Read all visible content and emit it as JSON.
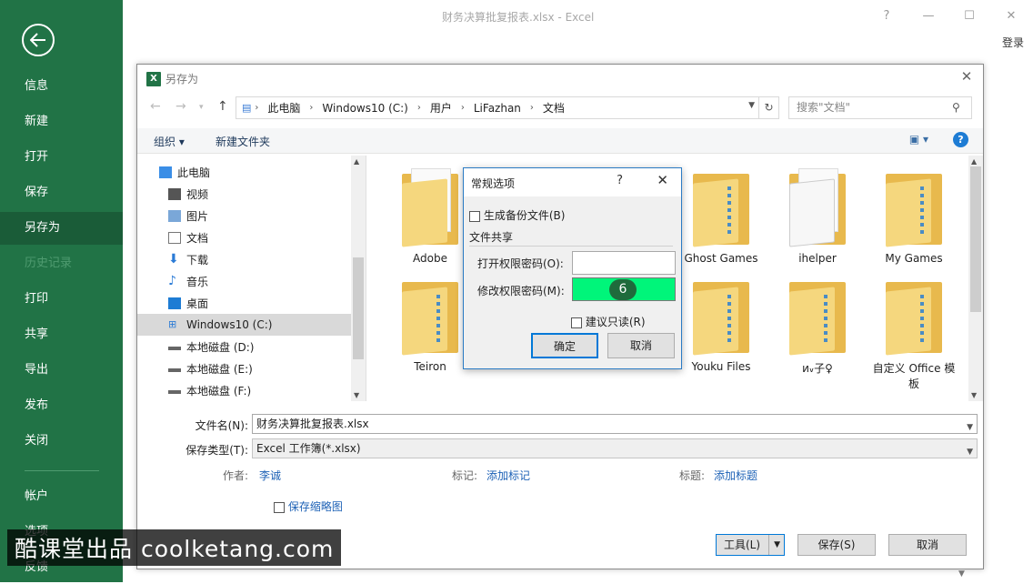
{
  "app": {
    "title": "财务决算批复报表.xlsx - Excel",
    "signin_label": "登录",
    "win_help": "?",
    "win_min": "—",
    "win_max": "☐",
    "win_close": "✕"
  },
  "backstage": {
    "back_icon": "back-arrow-icon",
    "items": [
      {
        "label": "信息"
      },
      {
        "label": "新建"
      },
      {
        "label": "打开"
      },
      {
        "label": "保存"
      },
      {
        "label": "另存为"
      },
      {
        "label": "历史记录"
      },
      {
        "label": "打印"
      },
      {
        "label": "共享"
      },
      {
        "label": "导出"
      },
      {
        "label": "发布"
      },
      {
        "label": "关闭"
      },
      {
        "label": "帐户"
      },
      {
        "label": "选项"
      },
      {
        "label": "反馈"
      }
    ],
    "active": "另存为",
    "accent": "#217346"
  },
  "saveas": {
    "title": "另存为",
    "close": "✕",
    "breadcrumb": [
      "此电脑",
      "Windows10 (C:)",
      "用户",
      "LiFazhan",
      "文档"
    ],
    "search_placeholder": "搜索\"文档\"",
    "toolbar": {
      "organize": "组织 ▾",
      "new_folder": "新建文件夹",
      "help": "?"
    },
    "nav_items": [
      {
        "label": "此电脑",
        "icon": "computer-icon"
      },
      {
        "label": "视频",
        "icon": "video-icon"
      },
      {
        "label": "图片",
        "icon": "pictures-icon"
      },
      {
        "label": "文档",
        "icon": "documents-icon"
      },
      {
        "label": "下载",
        "icon": "download-icon"
      },
      {
        "label": "音乐",
        "icon": "music-icon"
      },
      {
        "label": "桌面",
        "icon": "desktop-icon"
      },
      {
        "label": "Windows10 (C:)",
        "icon": "drive-c-icon"
      },
      {
        "label": "本地磁盘 (D:)",
        "icon": "drive-icon"
      },
      {
        "label": "本地磁盘 (E:)",
        "icon": "drive-icon"
      },
      {
        "label": "本地磁盘 (F:)",
        "icon": "drive-icon"
      }
    ],
    "selected_nav": "Windows10 (C:)",
    "folders": [
      {
        "label": "Adobe"
      },
      {
        "label": "Ghost Games"
      },
      {
        "label": "ihelper"
      },
      {
        "label": "My Games"
      },
      {
        "label": "Teiron"
      },
      {
        "label": "Youku Files"
      },
      {
        "label": "и៴子♀"
      },
      {
        "label": "自定义 Office 模板"
      }
    ],
    "filename_label": "文件名(N):",
    "filename_value": "财务决算批复报表.xlsx",
    "filetype_label": "保存类型(T):",
    "filetype_value": "Excel 工作簿(*.xlsx)",
    "author_label": "作者:",
    "author_value": "李诚",
    "tags_label": "标记:",
    "tags_value": "添加标记",
    "title_label": "标题:",
    "title_value": "添加标题",
    "thumbnail_label": "保存缩略图",
    "tools_label": "工具(L)",
    "save_label": "保存(S)",
    "cancel_label": "取消"
  },
  "general_options": {
    "title": "常规选项",
    "help": "?",
    "close": "✕",
    "backup_label": "生成备份文件(B)",
    "sharing_header": "文件共享",
    "open_pwd_label": "打开权限密码(O):",
    "modify_pwd_label": "修改权限密码(M):",
    "step_badge": "6",
    "readonly_label": "建议只读(R)",
    "ok_label": "确定",
    "cancel_label": "取消"
  },
  "watermark": "酷课堂出品 coolketang.com"
}
